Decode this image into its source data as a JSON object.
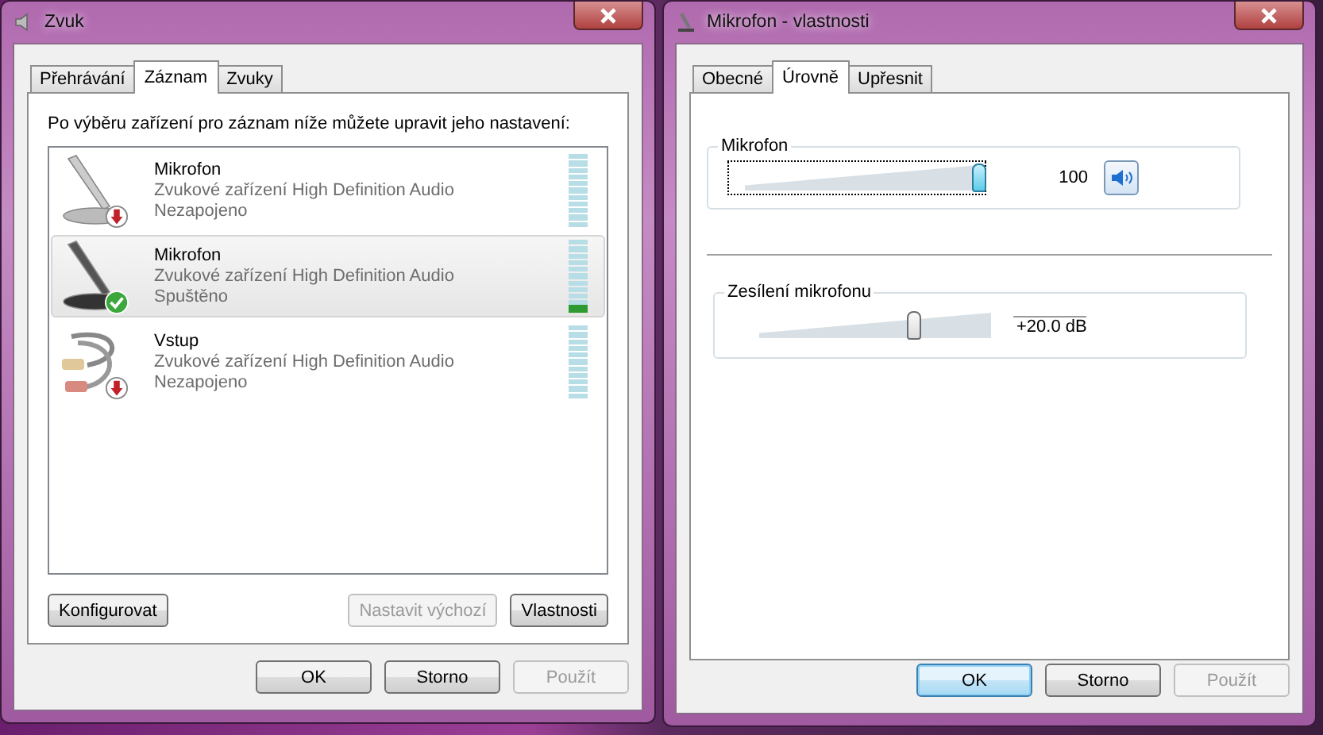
{
  "sound_window": {
    "title": "Zvuk",
    "tabs": [
      {
        "label": "Přehrávání",
        "selected": false
      },
      {
        "label": "Záznam",
        "selected": true
      },
      {
        "label": "Zvuky",
        "selected": false
      }
    ],
    "intro": "Po výběru zařízení pro záznam níže můžete upravit jeho nastavení:",
    "devices": [
      {
        "kind": "microphone",
        "name": "Mikrofon",
        "description": "Zvukové zařízení High Definition Audio",
        "status": "Nezapojeno",
        "connected": false,
        "selected": false
      },
      {
        "kind": "microphone",
        "name": "Mikrofon",
        "description": "Zvukové zařízení High Definition Audio",
        "status": "Spuštěno",
        "connected": true,
        "selected": true,
        "level": 0.1
      },
      {
        "kind": "line-in",
        "name": "Vstup",
        "description": "Zvukové zařízení High Definition Audio",
        "status": "Nezapojeno",
        "connected": false,
        "selected": false
      }
    ],
    "left_buttons": [
      {
        "label": "Konfigurovat",
        "disabled": false
      }
    ],
    "right_buttons": [
      {
        "label": "Nastavit výchozí",
        "disabled": true
      },
      {
        "label": "Vlastnosti",
        "disabled": false
      }
    ],
    "dialog_buttons": [
      {
        "label": "OK",
        "disabled": false,
        "default": false
      },
      {
        "label": "Storno",
        "disabled": false,
        "default": false
      },
      {
        "label": "Použít",
        "disabled": true,
        "default": false
      }
    ]
  },
  "properties_window": {
    "title": "Mikrofon - vlastnosti",
    "tabs": [
      {
        "label": "Obecné",
        "selected": false
      },
      {
        "label": "Úrovně",
        "selected": true
      },
      {
        "label": "Upřesnit",
        "selected": false
      }
    ],
    "volume": {
      "label": "Mikrofon",
      "level": 1,
      "reading": "100",
      "muted": false,
      "focused": true
    },
    "boost": {
      "label": "Zesílení mikrofonu",
      "level": 0.67,
      "reading": "+20.0 dB"
    },
    "dialog_buttons": [
      {
        "label": "OK",
        "disabled": false,
        "default": true
      },
      {
        "label": "Storno",
        "disabled": false,
        "default": false
      },
      {
        "label": "Použít",
        "disabled": true,
        "default": false
      }
    ]
  }
}
